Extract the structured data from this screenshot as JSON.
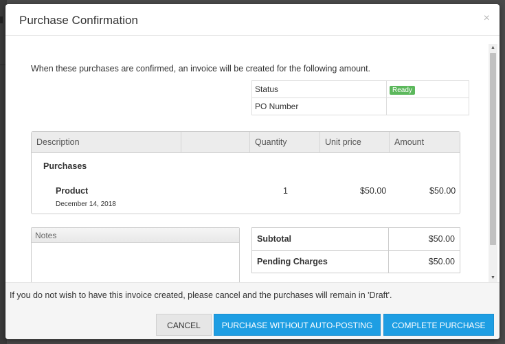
{
  "modal": {
    "title": "Purchase Confirmation",
    "close_glyph": "×",
    "intro": "When these purchases are confirmed, an invoice will be created for the following amount."
  },
  "status_table": {
    "rows": [
      {
        "label": "Status",
        "value": "Ready"
      },
      {
        "label": "PO Number",
        "value": ""
      }
    ],
    "status_badge_color": "#5cb85c"
  },
  "items": {
    "columns": [
      "Description",
      "",
      "Quantity",
      "Unit price",
      "Amount"
    ],
    "group": "Purchases",
    "rows": [
      {
        "name": "Product",
        "date": "December 14, 2018",
        "quantity": "1",
        "unit_price": "$50.00",
        "amount": "$50.00"
      }
    ]
  },
  "notes": {
    "label": "Notes",
    "value": ""
  },
  "totals": {
    "rows": [
      {
        "label": "Subtotal",
        "value": "$50.00"
      },
      {
        "label": "Pending Charges",
        "value": "$50.00"
      }
    ]
  },
  "footer": {
    "message": "If you do not wish to have this invoice created, please cancel and the purchases will remain in 'Draft'.",
    "cancel_label": "CANCEL",
    "no_post_label": "PURCHASE WITHOUT AUTO-POSTING",
    "complete_label": "COMPLETE PURCHASE"
  },
  "icons": {
    "scroll_up": "caret-up-icon",
    "scroll_down": "caret-down-icon",
    "close": "close-icon"
  },
  "colors": {
    "primary": "#1e9ee3",
    "cancel": "#e6e6e6"
  }
}
